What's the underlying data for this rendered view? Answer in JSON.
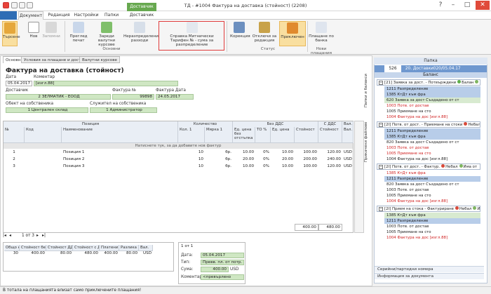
{
  "window": {
    "title": "ТД - #1004 Фактура на доставка (стойност) (2208)",
    "context_tab": "Доставчик"
  },
  "ribbon_tabs": [
    "Документ",
    "Редакция",
    "Настройки",
    "Папки",
    "Доставчик"
  ],
  "ribbon": {
    "search": "Търсене",
    "new": "Нов",
    "save": "Запомни",
    "preview": "Преглед печат",
    "load_rates": "Зареди валутни курсове",
    "undistributed": "Неразпределени разходи",
    "customs": "Справка Митнически Тарифен № - сума за разпределение",
    "correction": "Корекция",
    "cancel_edit": "Отключи за редакция",
    "accepted": "Приключен",
    "bank_payment": "Плащане по банка",
    "group_main": "Основни",
    "group_status": "Статус",
    "group_new_payment": "Нови плащания"
  },
  "panel_tabs": [
    "Основни",
    "Условия за плащане и доставка",
    "Валутни курсове"
  ],
  "form": {
    "doc_title": "Фактура на доставка (стойност)",
    "date_label": "Дата",
    "date": "05.04.2017",
    "comment_label": "Коментар",
    "comment": "[изгл.88]",
    "supplier_label": "Доставчик",
    "supplier": "2 ЗЕЛМАТИК - ЕООД",
    "invoice_no_label": "Фактура №",
    "invoice_no": "99898",
    "invoice_date_label": "Фактура Дата",
    "invoice_date": "24.05.2017",
    "owner_obj_label": "Обект на собственика",
    "owner_obj": "1 Централен склад",
    "owner_emp_label": "Служител на собственика",
    "owner_emp": "1 Администратор"
  },
  "grid": {
    "group_headers": [
      "Позиция",
      "Количество",
      "Без ДДС",
      "С ДДС",
      "Вал."
    ],
    "headers": [
      "№",
      "Код",
      "Наименование",
      "Кол. 1",
      "Мярка 1",
      "Ед. цена без отстъпка",
      "ТО %",
      "Ед. цена",
      "Стойност",
      "Стойност",
      "Вал."
    ],
    "new_row_hint": "Натиснете тук, за да добавите нов фактур",
    "rows": [
      {
        "no": "1",
        "name": "Позиция 1",
        "qty": "10",
        "unit": "бр.",
        "price_base": "10.00",
        "disc": "0%",
        "price": "10.00",
        "value": "100.00",
        "value_vat": "120.00",
        "cur": "USD"
      },
      {
        "no": "2",
        "name": "Позиция 2",
        "qty": "10",
        "unit": "бр.",
        "price_base": "20.00",
        "disc": "0%",
        "price": "20.00",
        "value": "200.00",
        "value_vat": "240.00",
        "cur": "USD"
      },
      {
        "no": "3",
        "name": "Позиция 3",
        "qty": "10",
        "unit": "бр.",
        "price_base": "10.00",
        "disc": "0%",
        "price": "10.00",
        "value": "100.00",
        "value_vat": "120.00",
        "cur": "USD"
      }
    ],
    "total": "400.00",
    "total_vat": "480.00",
    "nav": "1 от 3"
  },
  "summary": {
    "headers": [
      "Общо кол.",
      "Стойност без ДДС",
      "Стойност ДДС",
      "Стойност с ДДС",
      "Платени",
      "Разлика",
      "Вал."
    ],
    "values": [
      "30",
      "400.00",
      "80.00",
      "480.00",
      "400.00",
      "80.00",
      "USD"
    ]
  },
  "payment": {
    "nav": "1 от 1",
    "date_label": "Дата:",
    "date": "05.04.2017",
    "type_label": "Тип:",
    "type": "Превв. пл. от потр. (д",
    "sum_label": "Сума:",
    "sum": "400.00",
    "sum_cur": "USD",
    "comment_label": "Коментар:",
    "comment": "<превърлено"
  },
  "status_bar": "В тотала на плащанията влизат само приключените плащания!",
  "side_strip": [
    "Папки и баланси",
    "Прикачени файлове"
  ],
  "right_panel": {
    "header": "Папка",
    "folder_no": "526",
    "folder_name": "20. Доставки020/05.04.17",
    "balance": "Баланс",
    "nodes": [
      {
        "title": "[21] Заявка за дост. - Потвърждени",
        "badge": "Балан",
        "badge2": "Има от",
        "lines": [
          {
            "t": "1211 Разпределение",
            "c": "blue"
          },
          {
            "t": "1385 КтДт към фра",
            "c": "blue"
          },
          {
            "t": "620 Заявка за дост Създадено от ст",
            "c": "green"
          },
          {
            "t": "1003 Потв. от достав",
            "c": "red"
          },
          {
            "t": "1005 Приемане на сто",
            "c": ""
          },
          {
            "t": "1004 Фактура на дос [изгл.88]",
            "c": "red"
          }
        ]
      },
      {
        "title": "[2I] Потв. от дост. - Приемане на стоки",
        "badge": "Небал",
        "badge2": "Има от",
        "lines": [
          {
            "t": "1211 Разпределение",
            "c": "blue"
          },
          {
            "t": "1385 КтДт към фра",
            "c": "blue"
          },
          {
            "t": "820 Заявка за дост Създадено от ст",
            "c": ""
          },
          {
            "t": "1003 Потв. от достав",
            "c": "red"
          },
          {
            "t": "1005 Приемане на сто",
            "c": "red"
          },
          {
            "t": "1004 Фактура на дос [изгл.88]",
            "c": ""
          }
        ]
      },
      {
        "title": "[2I] Потв. от дост. - Фактур.",
        "badge": "Небал",
        "badge2": "Има от",
        "lines": [
          {
            "t": "1385 КтДт към фра",
            "c": "red"
          },
          {
            "t": "1211 Разпределение",
            "c": "blue"
          },
          {
            "t": "820 Заявка за дост Създадено от ст",
            "c": ""
          },
          {
            "t": "1003 Потв. от достав",
            "c": ""
          },
          {
            "t": "1005 Приемане на сто",
            "c": ""
          },
          {
            "t": "1004 Фактура на дос [изгл.88]",
            "c": "red"
          }
        ]
      },
      {
        "title": "[2I] Прием на стока - Фактуриране",
        "badge": "Небал",
        "badge2": "Има от",
        "lines": [
          {
            "t": "1385 КтДт към фра",
            "c": "green"
          },
          {
            "t": "1211 Разпределение",
            "c": "blue"
          },
          {
            "t": "1003 Потв. от достав",
            "c": ""
          },
          {
            "t": "1005 Приемане на сто",
            "c": ""
          },
          {
            "t": "1004 Фактура на дос [изгл.88]",
            "c": "red"
          }
        ]
      }
    ],
    "bottom_bars": [
      "Серийни/партидни номера",
      "Информация за документа"
    ]
  },
  "colors": {
    "accent": "#67a84f",
    "highlight": "#f9dfa0",
    "red_box": "#e03b3b"
  }
}
